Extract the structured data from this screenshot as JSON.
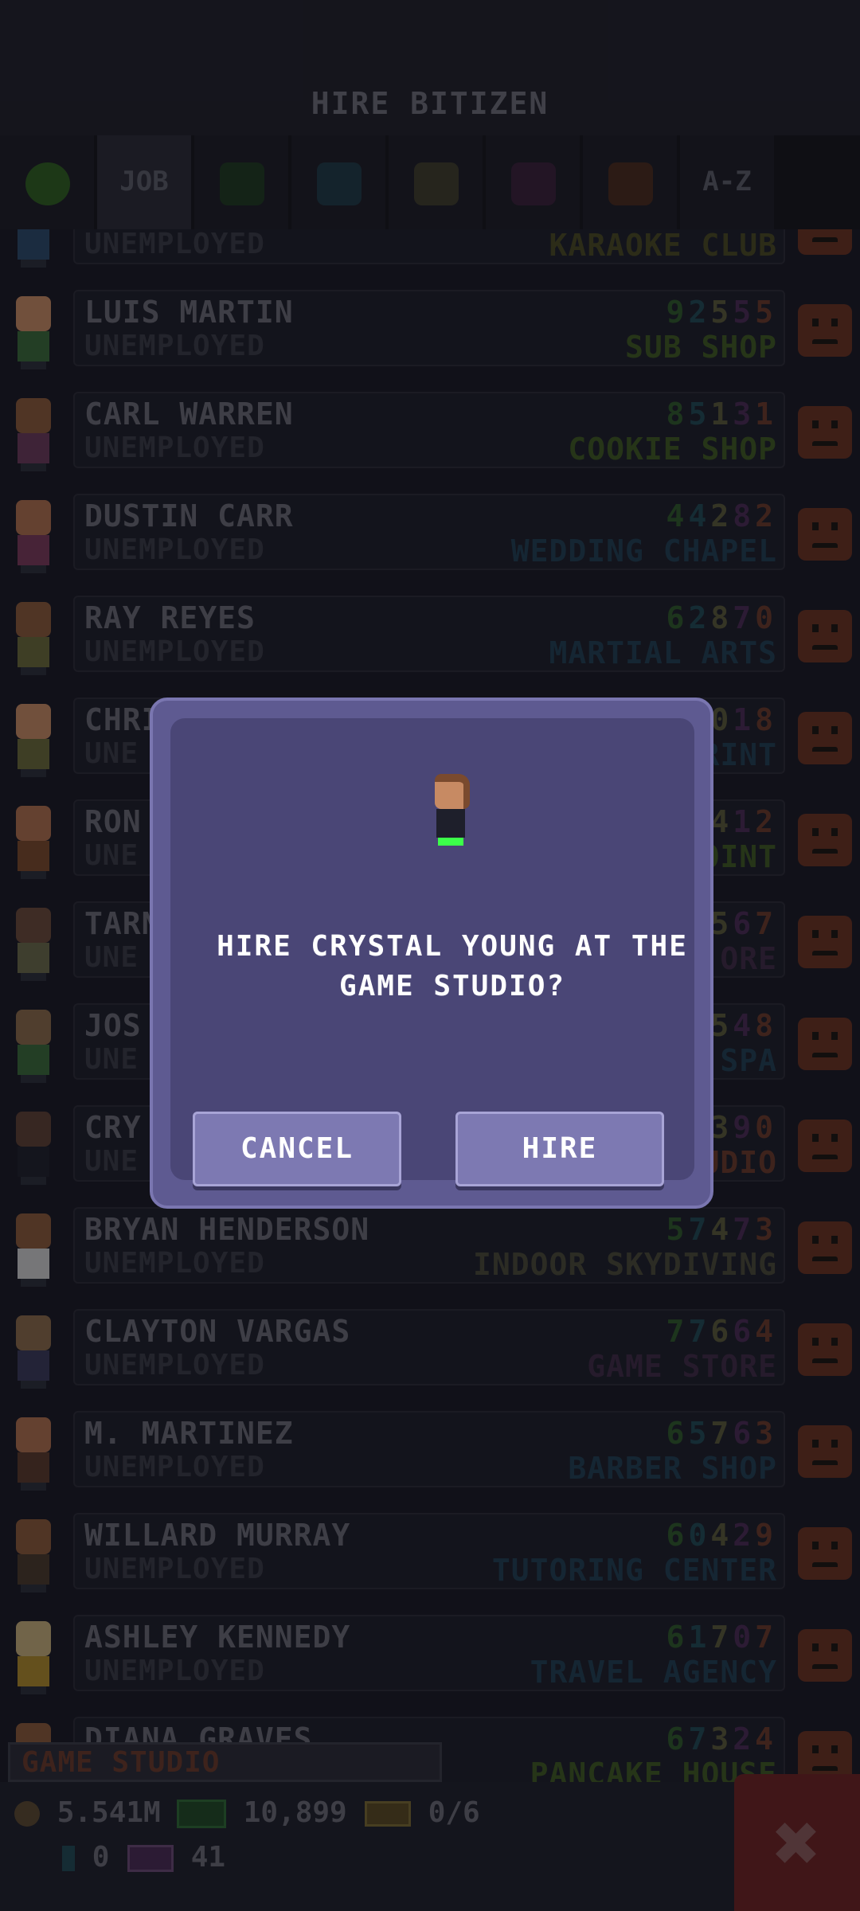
{
  "header": {
    "title": "HIRE BITIZEN"
  },
  "tabs": [
    {
      "kind": "face",
      "color": "#2f5f20"
    },
    {
      "kind": "text",
      "label": "JOB",
      "active": true
    },
    {
      "kind": "color",
      "color": "#1e3a1f"
    },
    {
      "kind": "color",
      "color": "#1e3a45"
    },
    {
      "kind": "color",
      "color": "#3f3d2a"
    },
    {
      "kind": "color",
      "color": "#3a1f3a"
    },
    {
      "kind": "color",
      "color": "#4a2a1c"
    },
    {
      "kind": "text",
      "label": "A-Z"
    }
  ],
  "rows": [
    {
      "name": "",
      "status": "UNEMPLOYED",
      "stats": "",
      "job": "KARAOKE CLUB",
      "job_color": "#4a4a22"
    },
    {
      "name": "LUIS MARTIN",
      "status": "UNEMPLOYED",
      "stats": "92555",
      "job": "SUB SHOP",
      "job_color": "#3e5a22"
    },
    {
      "name": "CARL WARREN",
      "status": "UNEMPLOYED",
      "stats": "85131",
      "job": "COOKIE SHOP",
      "job_color": "#3e5a22"
    },
    {
      "name": "DUSTIN CARR",
      "status": "UNEMPLOYED",
      "stats": "44282",
      "job": "WEDDING CHAPEL",
      "job_color": "#1f3e52"
    },
    {
      "name": "RAY REYES",
      "status": "UNEMPLOYED",
      "stats": "62870",
      "job": "MARTIAL ARTS",
      "job_color": "#1f3e52"
    },
    {
      "name": "CHRIS",
      "status": "UNE",
      "stats": "018",
      "job": "RINT",
      "job_color": "#1f3e52"
    },
    {
      "name": "RON",
      "status": "UNE",
      "stats": "412",
      "job": "OINT",
      "job_color": "#3e5a22"
    },
    {
      "name": "TARN",
      "status": "UNE",
      "stats": "567",
      "job": "ORE",
      "job_color": "#3e2a45"
    },
    {
      "name": "JOS",
      "status": "UNE",
      "stats": "548",
      "job": "SPA",
      "job_color": "#1f3e52"
    },
    {
      "name": "CRY",
      "status": "UNE",
      "stats": "390",
      "job": "UDIO",
      "job_color": "#6b3a28"
    },
    {
      "name": "BRYAN HENDERSON",
      "status": "UNEMPLOYED",
      "stats": "57473",
      "job": "INDOOR SKYDIVING",
      "job_color": "#4a4a38"
    },
    {
      "name": "CLAYTON VARGAS",
      "status": "UNEMPLOYED",
      "stats": "77664",
      "job": "GAME STORE",
      "job_color": "#3e2a45"
    },
    {
      "name": "M. MARTINEZ",
      "status": "UNEMPLOYED",
      "stats": "65763",
      "job": "BARBER SHOP",
      "job_color": "#1f3e52"
    },
    {
      "name": "WILLARD MURRAY",
      "status": "UNEMPLOYED",
      "stats": "60429",
      "job": "TUTORING CENTER",
      "job_color": "#1f3e52"
    },
    {
      "name": "ASHLEY KENNEDY",
      "status": "UNEMPLOYED",
      "stats": "61707",
      "job": "TRAVEL AGENCY",
      "job_color": "#1f3e52"
    },
    {
      "name": "DIANA GRAVES",
      "status": "",
      "stats": "67324",
      "job": "PANCAKE HOUSE",
      "job_color": "#3e5a22"
    }
  ],
  "stat_colors": [
    "#2f5a2a",
    "#1f4a55",
    "#5a5a3a",
    "#4a2a55",
    "#6b3a28"
  ],
  "dialog": {
    "question": "HIRE CRYSTAL YOUNG AT THE GAME STUDIO?",
    "cancel_label": "CANCEL",
    "hire_label": "HIRE"
  },
  "footer": {
    "store": "GAME STUDIO",
    "coins": "5.541M",
    "bux": "10,899",
    "tickets": "0/6",
    "keys": "0",
    "vip": "41",
    "close_icon": "✖"
  }
}
